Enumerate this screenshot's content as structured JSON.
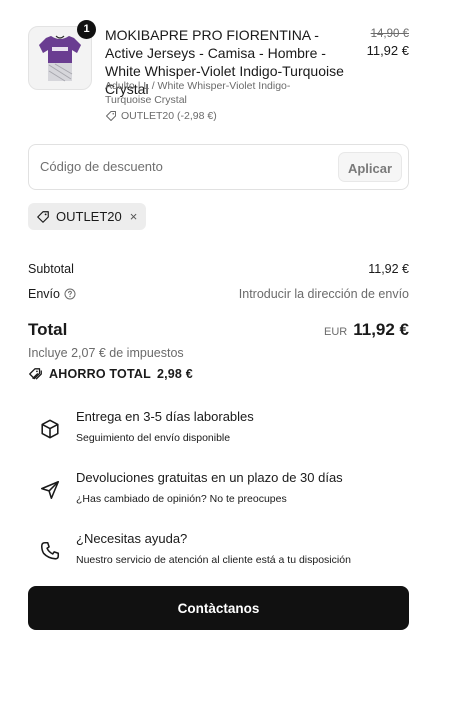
{
  "product": {
    "quantity": "1",
    "title": "MOKIBAPRE PRO FIORENTINA - Active Jerseys - Camisa - Hombre - White Whisper-Violet Indigo-Turquoise Crystal",
    "variant": "Adulto | L / White Whisper-Violet Indigo-Turquoise Crystal",
    "discount": "OUTLET20 (-2,98 €)",
    "price_original": "14,90 €",
    "price_final": "11,92 €",
    "image_icon": "jersey-thumbnail"
  },
  "discount_code": {
    "placeholder": "Código de descuento",
    "value": "",
    "apply_label": "Aplicar"
  },
  "applied_code": {
    "code": "OUTLET20",
    "remove_label": "×"
  },
  "summary": {
    "subtotal_label": "Subtotal",
    "subtotal_value": "11,92 €",
    "shipping_label": "Envío",
    "shipping_value": "Introducir la dirección de envío",
    "total_label": "Total",
    "currency": "EUR",
    "total_value": "11,92 €",
    "taxes_text": "Incluye 2,07 € de impuestos",
    "savings_label": "AHORRO TOTAL",
    "savings_value": "2,98 €"
  },
  "features": [
    {
      "icon": "box-icon",
      "title": "Entrega en 3-5 días laborables",
      "subtitle": "Seguimiento del envío disponible"
    },
    {
      "icon": "send-icon",
      "title": "Devoluciones gratuitas en un plazo de 30 días",
      "subtitle": "¿Has cambiado de opinión? No te preocupes"
    },
    {
      "icon": "phone-icon",
      "title": "¿Necesitas ayuda?",
      "subtitle": "Nuestro servicio de atención al cliente está a tu disposición"
    }
  ],
  "contact_button": "Contàctanos"
}
